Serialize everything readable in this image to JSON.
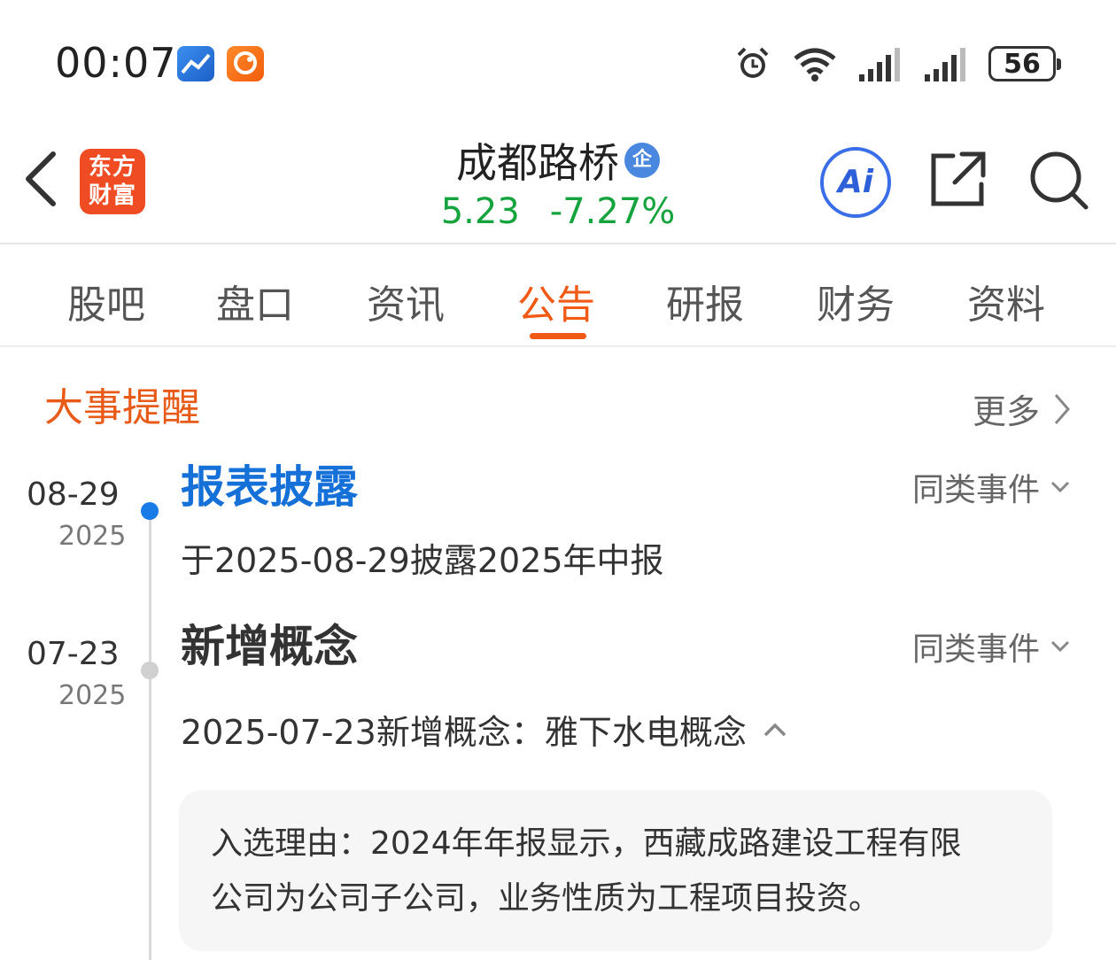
{
  "status_bar": {
    "time": "00:07",
    "battery": "56",
    "icons": [
      "alarm-icon",
      "wifi-icon",
      "signal-icon",
      "signal-icon",
      "battery-icon"
    ]
  },
  "header": {
    "logo_line1": "东方",
    "logo_line2": "财富",
    "stock_name": "成都路桥",
    "badge": "企",
    "price": "5.23",
    "change": "-7.27%",
    "ai_label": "Ai",
    "colors": {
      "down": "#14a33c",
      "accent": "#f05a14",
      "logo": "#f04c23",
      "ai": "#3a6ee8"
    }
  },
  "tabs": [
    {
      "label": "股吧"
    },
    {
      "label": "盘口"
    },
    {
      "label": "资讯"
    },
    {
      "label": "公告",
      "active": true
    },
    {
      "label": "研报"
    },
    {
      "label": "财务"
    },
    {
      "label": "资料"
    }
  ],
  "section": {
    "title": "大事提醒",
    "more": "更多"
  },
  "events": [
    {
      "date": "08-29",
      "year": "2025",
      "title": "报表披露",
      "similar": "同类事件",
      "desc": "于2025-08-29披露2025年中报"
    },
    {
      "date": "07-23",
      "year": "2025",
      "title": "新增概念",
      "similar": "同类事件",
      "desc": "2025-07-23新增概念：雅下水电概念",
      "reason_line1": "入选理由：2024年年报显示，西藏成路建设工程有限",
      "reason_line2": "公司为公司子公司，业务性质为工程项目投资。"
    }
  ]
}
